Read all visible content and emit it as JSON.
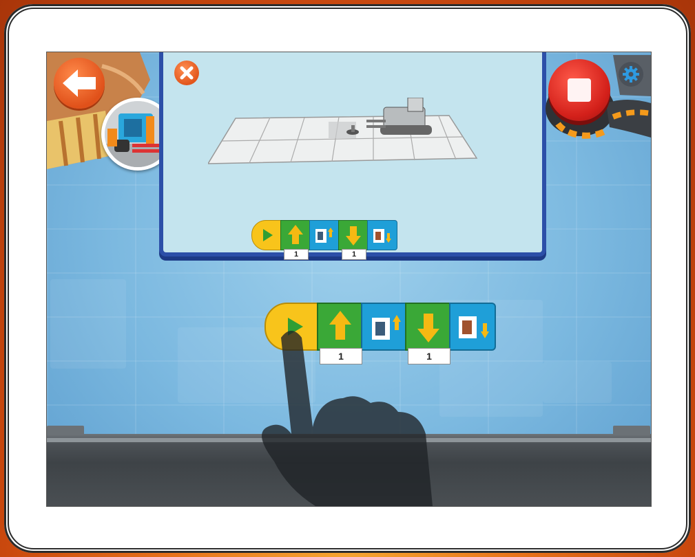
{
  "colors": {
    "start_block": "#f8c41b",
    "move_block": "#3aa837",
    "action_block": "#1f9fd8",
    "arrow": "#f6b913",
    "stop_button": "#d3201a",
    "back_button": "#e0511a"
  },
  "icons": {
    "back": "arrow-left-icon",
    "close": "close-icon",
    "stop": "stop-icon",
    "settings": "gear-icon",
    "play": "play-icon",
    "forward": "arrow-up-icon",
    "backward": "arrow-down-icon",
    "pick_up": "forklift-up-icon",
    "drop": "forklift-down-icon"
  },
  "tutorial": {
    "program": [
      {
        "type": "start"
      },
      {
        "type": "move-forward",
        "param": "1"
      },
      {
        "type": "fork-up"
      },
      {
        "type": "move-backward",
        "param": "1"
      },
      {
        "type": "fork-down"
      }
    ]
  },
  "workspace": {
    "program": [
      {
        "type": "start"
      },
      {
        "type": "move-forward",
        "param": "1"
      },
      {
        "type": "fork-up"
      },
      {
        "type": "move-backward",
        "param": "1"
      },
      {
        "type": "fork-down"
      }
    ]
  },
  "tutorial_params": {
    "forward": "1",
    "backward": "1"
  },
  "workspace_params": {
    "forward": "1",
    "backward": "1"
  }
}
